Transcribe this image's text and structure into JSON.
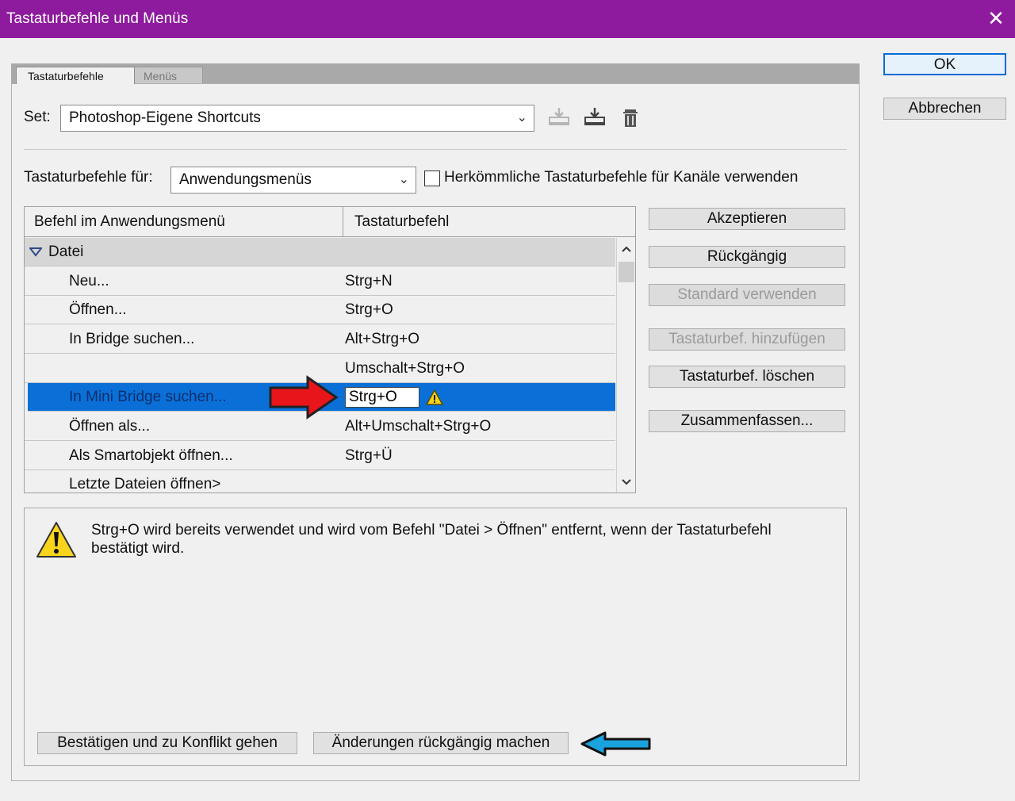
{
  "window": {
    "title": "Tastaturbefehle und Menüs",
    "close_glyph": "✕"
  },
  "tabs": [
    {
      "label": "Tastaturbefehle"
    },
    {
      "label": "Menüs"
    }
  ],
  "set": {
    "label": "Set:",
    "value": "Photoshop-Eigene Shortcuts"
  },
  "shortcuts_for": {
    "label": "Tastaturbefehle für:",
    "value": "Anwendungsmenüs",
    "checkbox_label": "Herkömmliche Tastaturbefehle für Kanäle verwenden"
  },
  "table": {
    "col_command": "Befehl im Anwendungsmenü",
    "col_shortcut": "Tastaturbefehl",
    "group": "Datei",
    "rows": [
      {
        "cmd": "Neu...",
        "key": "Strg+N"
      },
      {
        "cmd": "Öffnen...",
        "key": "Strg+O"
      },
      {
        "cmd": "In Bridge suchen...",
        "key": "Alt+Strg+O"
      },
      {
        "cmd": "",
        "key": "Umschalt+Strg+O"
      },
      {
        "cmd": "In Mini Bridge suchen...",
        "key": "Strg+O"
      },
      {
        "cmd": "Öffnen als...",
        "key": "Alt+Umschalt+Strg+O"
      },
      {
        "cmd": "Als Smartobjekt öffnen...",
        "key": "Strg+Ü"
      },
      {
        "cmd": "Letzte Dateien öffnen>",
        "key": ""
      }
    ]
  },
  "side_buttons": {
    "accept": "Akzeptieren",
    "undo": "Rückgängig",
    "use_default": "Standard verwenden",
    "add_shortcut": "Tastaturbef. hinzufügen",
    "delete_shortcut": "Tastaturbef. löschen",
    "summarize": "Zusammenfassen..."
  },
  "dialog_buttons": {
    "ok": "OK",
    "cancel": "Abbrechen"
  },
  "message": {
    "text": "Strg+O wird bereits verwendet und wird vom Befehl \"Datei > Öffnen\" entfernt, wenn der Tastaturbefehl bestätigt wird.",
    "confirm_button": "Bestätigen und zu Konflikt gehen",
    "revert_button": "Änderungen rückgängig machen"
  },
  "colors": {
    "titlebar": "#8e1a9d",
    "selection": "#0a70d8",
    "red_arrow": "#e8151b",
    "blue_arrow": "#1aa2dd"
  }
}
